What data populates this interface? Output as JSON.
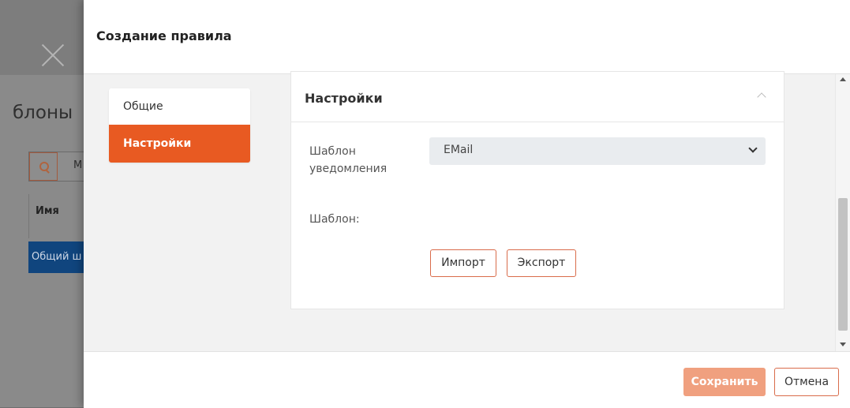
{
  "background": {
    "heading": "блоны",
    "search_text": "М",
    "column_header": "Имя",
    "row_text": "Общий ш",
    "close_icon": "close-icon",
    "search_icon": "search-icon"
  },
  "modal": {
    "title": "Создание правила",
    "nav": {
      "items": [
        {
          "label": "Общие",
          "active": false
        },
        {
          "label": "Настройки",
          "active": true
        }
      ]
    },
    "panel": {
      "title": "Настройки",
      "toggle_icon": "chevron-up-icon",
      "template_label_line1": "Шаблон",
      "template_label_line2": "уведомления",
      "template_select_value": "EMail",
      "template_body_label": "Шаблон:",
      "import_label": "Импорт",
      "export_label": "Экспорт"
    },
    "footer": {
      "save_label": "Сохранить",
      "cancel_label": "Отмена"
    }
  },
  "colors": {
    "accent": "#e85a22",
    "save_button": "#f0a07f",
    "selected_row": "#10457e"
  }
}
